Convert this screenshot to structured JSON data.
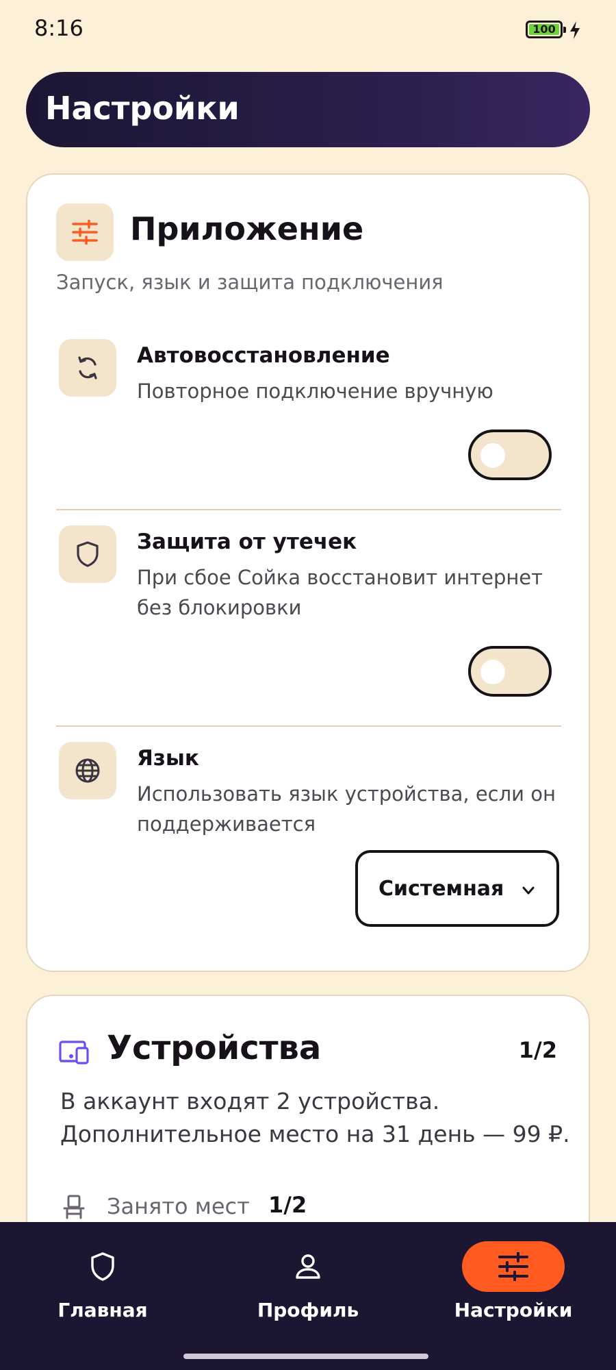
{
  "status_bar": {
    "time": "8:16",
    "battery_level": "100",
    "battery_color": "#6fd13b"
  },
  "header": {
    "title": "Настройки"
  },
  "app_section": {
    "icon": "sliders-icon",
    "title": "Приложение",
    "subtitle": "Запуск, язык и защита подключения",
    "rows": [
      {
        "icon": "refresh-icon",
        "title": "Автовосстановление",
        "description": "Повторное подключение вручную",
        "toggle_on": false
      },
      {
        "icon": "shield-icon",
        "title": "Защита от утечек",
        "description": "При сбое Сойка восстановит интернет без блокировки",
        "toggle_on": false
      },
      {
        "icon": "globe-icon",
        "title": "Язык",
        "description": "Использовать язык устройства, если он поддерживается",
        "select_value": "Системная"
      }
    ]
  },
  "devices_section": {
    "icon": "devices-icon",
    "title": "Устройства",
    "count": "1/2",
    "description": "В аккаунт входят 2 устройства. Дополнительное место на 31 день — 99 ₽.",
    "slots_label": "Занято мест",
    "slots_value": "1/2"
  },
  "bottom_nav": {
    "items": [
      {
        "label": "Главная",
        "icon": "shield-icon",
        "active": false
      },
      {
        "label": "Профиль",
        "icon": "person-icon",
        "active": false
      },
      {
        "label": "Настройки",
        "icon": "sliders-icon",
        "active": true
      }
    ]
  },
  "colors": {
    "background": "#fdf0d8",
    "accent": "#ff5a1f",
    "header_dark": "#1c1633",
    "devices_icon": "#6c4ef0"
  }
}
